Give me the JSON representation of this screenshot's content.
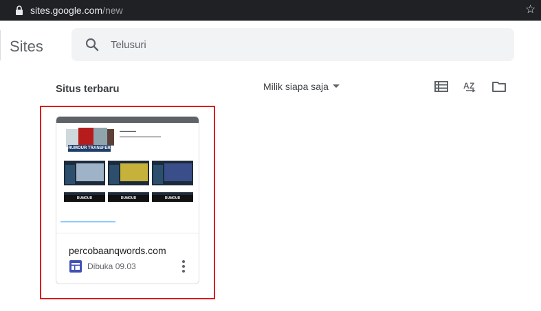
{
  "browser": {
    "url_host": "sites.google.com",
    "url_path": "/new"
  },
  "app": {
    "title": "Sites"
  },
  "search": {
    "placeholder": "Telusuri"
  },
  "section": {
    "title": "Situs terbaru",
    "owner_filter": "Milik siapa saja"
  },
  "sites": [
    {
      "name": "percobaanqwords.com",
      "opened": "Dibuka 09.03",
      "thumbnail": {
        "header_text": "RUMOUR TRANSFER",
        "poster_labels": [
          "RUMOUR",
          "RUMOUR",
          "RUMOUR"
        ]
      }
    }
  ],
  "colors": {
    "highlight": "#e0141e",
    "site_icon": "#3f51b5",
    "chrome_bar": "#202124"
  }
}
